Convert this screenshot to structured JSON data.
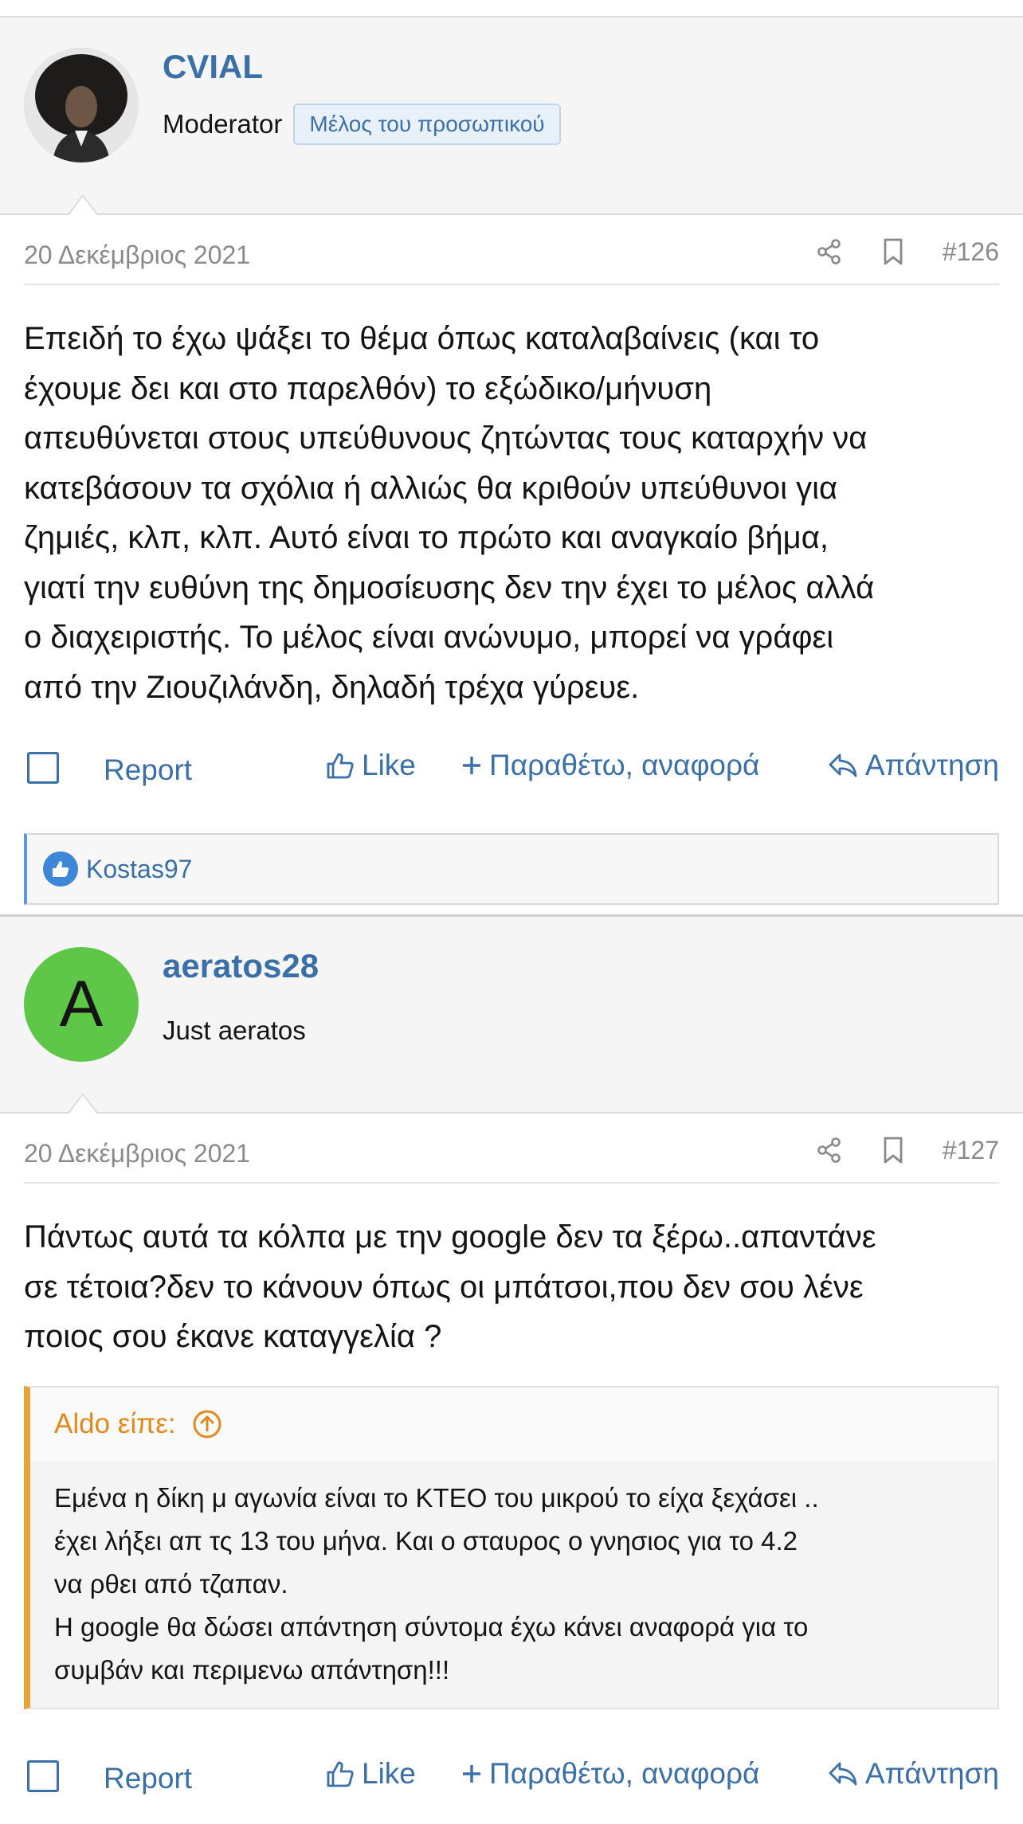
{
  "colors": {
    "link": "#3a6fa8",
    "quote_accent": "#e8a23a",
    "avatar_bg": "#5ec748",
    "reaction": "#3d86d8"
  },
  "posts": [
    {
      "username": "CVIAL",
      "user_title": "Moderator",
      "staff_badge": "Μέλος του προσωπικού",
      "date": "20 Δεκέμβριος 2021",
      "number": "#126",
      "body_lines": [
        "Επειδή το έχω ψάξει το θέμα όπως καταλαβαίνεις (και το",
        "έχουμε δει και στο παρελθόν) το εξώδικο/μήνυση",
        "απευθύνεται στους υπεύθυνους ζητώντας τους καταρχήν να",
        "κατεβάσουν τα σχόλια ή αλλιώς θα κριθούν υπεύθυνοι για",
        "ζημιές, κλπ, κλπ. Αυτό είναι το πρώτο και αναγκαίο βήμα,",
        "γιατί την ευθύνη της δημοσίευσης δεν την έχει το μέλος αλλά",
        "ο διαχειριστής. Το μέλος είναι ανώνυμο, μπορεί να γράφει",
        "από την Ζιουζιλάνδη, δηλαδή τρέχα γύρευε."
      ],
      "reacted_by": "Kostas97"
    },
    {
      "username": "aeratos28",
      "avatar_letter": "A",
      "user_title": "Just aeratos",
      "date": "20 Δεκέμβριος 2021",
      "number": "#127",
      "body_lines": [
        "Πάντως αυτά τα κόλπα με την google δεν τα ξέρω..απαντάνε",
        "σε τέτοια?δεν το κάνουν όπως οι μπάτσοι,που δεν σου λένε",
        "ποιος σου έκανε καταγγελία ?"
      ],
      "quote": {
        "author": "Aldo είπε:",
        "lines": [
          "Εμένα η δίκη μ αγωνία είναι το ΚΤΕΟ του μικρού το είχα ξεχάσει ..",
          "έχει λήξει απ τς 13 του μήνα. Και ο σταυρος ο γνησιος για το 4.2",
          "να ρθει από τζαπαν.",
          "Η google θα δώσει απάντηση σύντομα έχω κάνει αναφορά για το",
          "συμβάν και περιμενω απάντηση!!!"
        ]
      }
    }
  ],
  "actions": {
    "report": "Report",
    "like": "Like",
    "quote": "Παραθέτω, αναφορά",
    "reply": "Απάντηση"
  },
  "icons": [
    "share-icon",
    "bookmark-icon",
    "thumbs-up-icon",
    "plus-icon",
    "reply-icon",
    "arrow-up-circle-icon"
  ]
}
